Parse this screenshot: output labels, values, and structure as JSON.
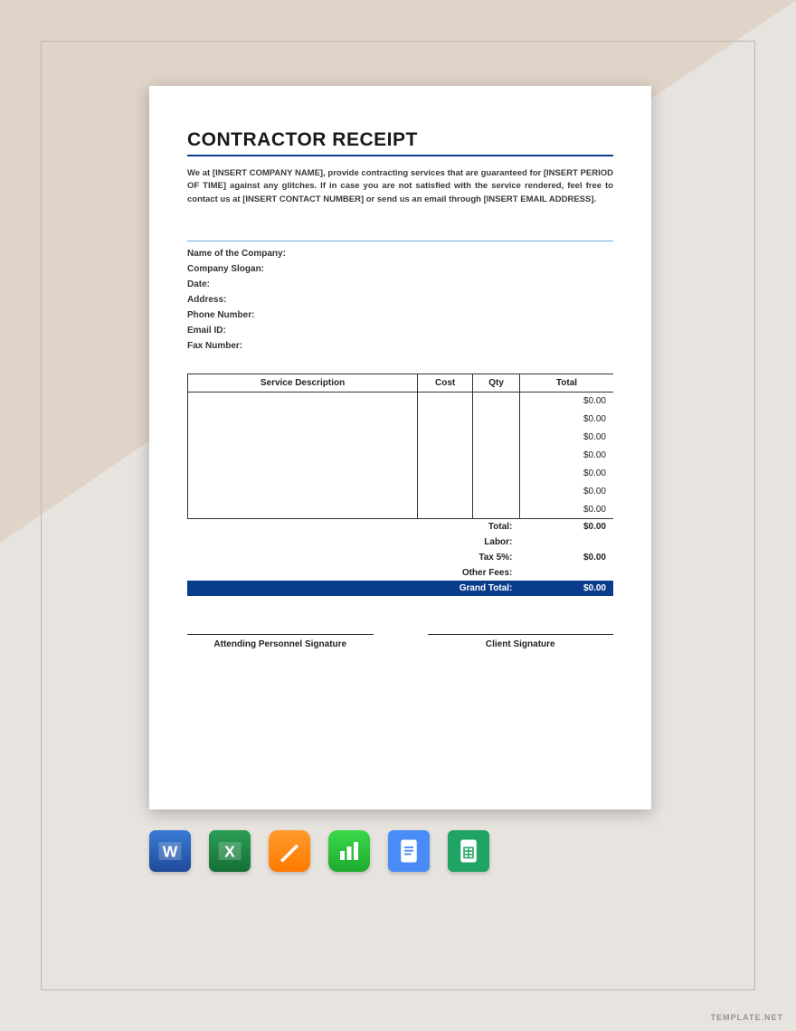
{
  "title": "CONTRACTOR RECEIPT",
  "intro": "We at [INSERT COMPANY NAME], provide contracting services that are guaranteed for [INSERT PERIOD OF TIME] against any glitches. If in case you are not satisfied with the service rendered, feel free to contact us at [INSERT CONTACT NUMBER] or send us an email through [INSERT EMAIL ADDRESS].",
  "fields": [
    "Name of the Company:",
    "Company Slogan:",
    "Date:",
    "Address:",
    "Phone Number:",
    "Email ID:",
    "Fax Number:"
  ],
  "tableHeaders": {
    "desc": "Service Description",
    "cost": "Cost",
    "qty": "Qty",
    "total": "Total"
  },
  "rows": [
    {
      "desc": "",
      "cost": "",
      "qty": "",
      "total": "$0.00"
    },
    {
      "desc": "",
      "cost": "",
      "qty": "",
      "total": "$0.00"
    },
    {
      "desc": "",
      "cost": "",
      "qty": "",
      "total": "$0.00"
    },
    {
      "desc": "",
      "cost": "",
      "qty": "",
      "total": "$0.00"
    },
    {
      "desc": "",
      "cost": "",
      "qty": "",
      "total": "$0.00"
    },
    {
      "desc": "",
      "cost": "",
      "qty": "",
      "total": "$0.00"
    },
    {
      "desc": "",
      "cost": "",
      "qty": "",
      "total": "$0.00"
    }
  ],
  "summary": [
    {
      "label": "Total:",
      "value": "$0.00"
    },
    {
      "label": "Labor:",
      "value": ""
    },
    {
      "label": "Tax 5%:",
      "value": "$0.00"
    },
    {
      "label": "Other Fees:",
      "value": ""
    }
  ],
  "grandTotal": {
    "label": "Grand Total:",
    "value": "$0.00"
  },
  "signatures": {
    "left": "Attending Personnel Signature",
    "right": "Client Signature"
  },
  "watermark": "TEMPLATE.NET",
  "icons": [
    "word",
    "excel",
    "pages",
    "numbers",
    "gdoc",
    "gsheet"
  ]
}
